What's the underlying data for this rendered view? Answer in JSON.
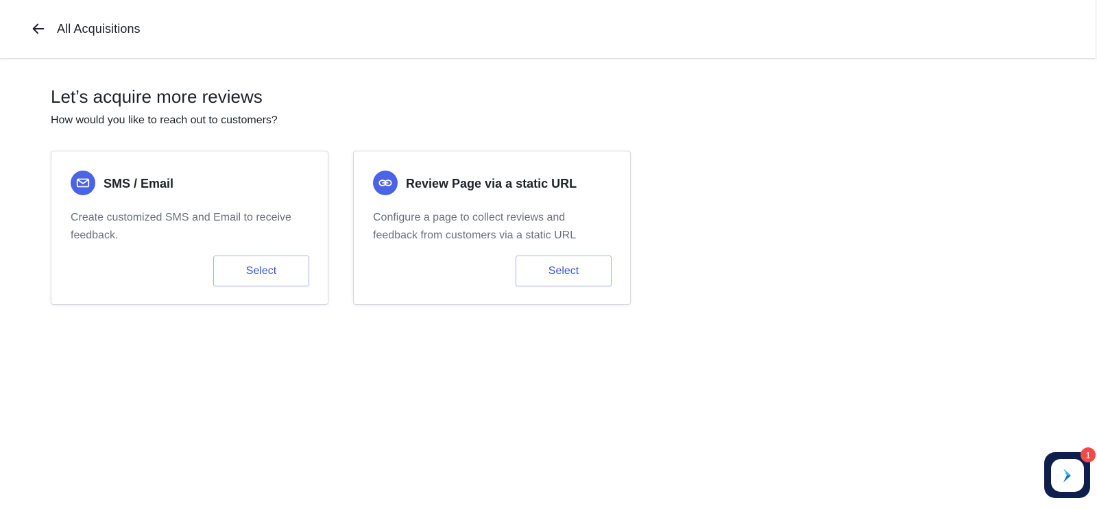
{
  "header": {
    "title": "All Acquisitions",
    "back_icon": "arrow-left-icon"
  },
  "main": {
    "heading": "Let’s acquire more reviews",
    "subheading": "How would you like to reach out to customers?",
    "options": [
      {
        "icon": "mail-icon",
        "title": "SMS / Email",
        "description": "Create customized SMS and Email to receive feedback.",
        "button_label": "Select"
      },
      {
        "icon": "link-icon",
        "title": "Review Page via a static URL",
        "description": "Configure a page to collect reviews and feedback from customers via a static URL",
        "button_label": "Select"
      }
    ]
  },
  "chat_widget": {
    "icon": "chat-logo-icon",
    "badge_count": "1"
  },
  "colors": {
    "accent": "#4a63e7",
    "button_text": "#3a55d6",
    "badge": "#f04b4b",
    "widget_bg": "#0f1f4d"
  }
}
